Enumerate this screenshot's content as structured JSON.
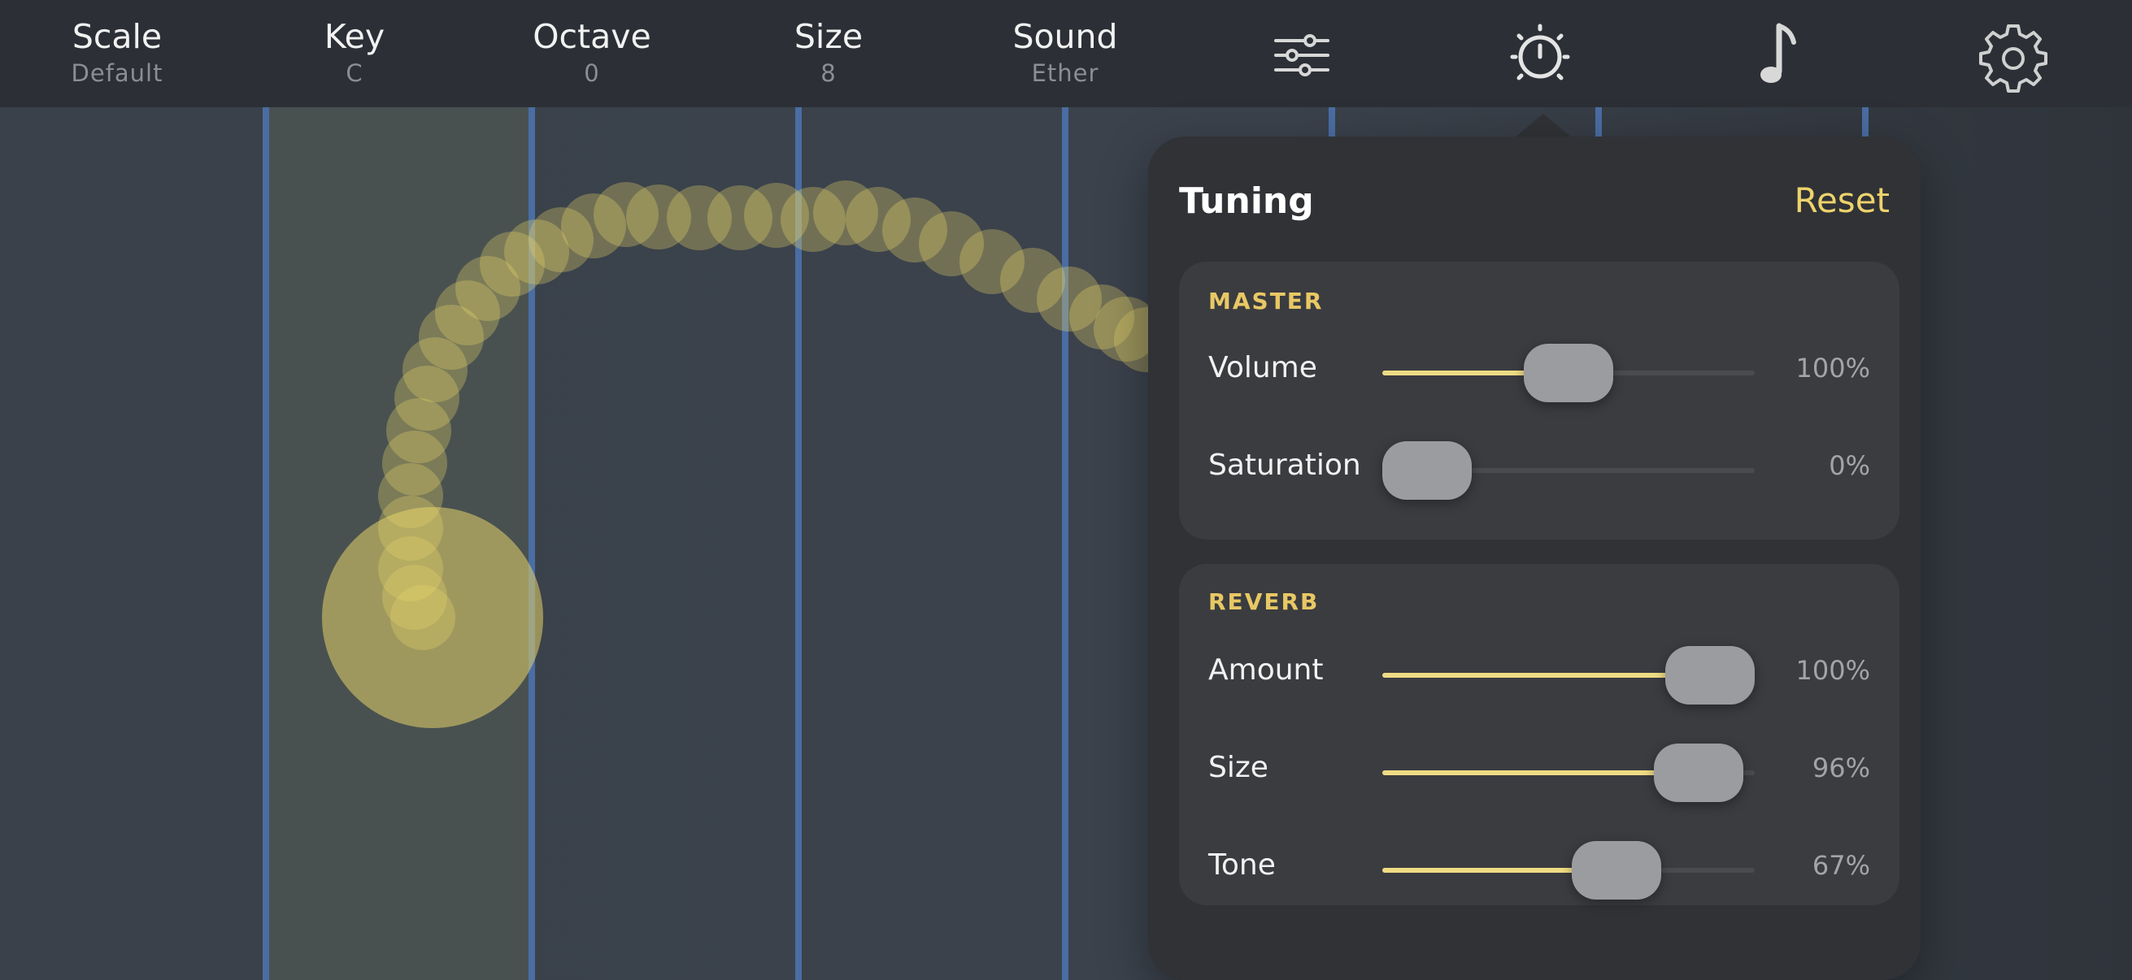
{
  "topbar": {
    "items": [
      {
        "title": "Scale",
        "value": "Default"
      },
      {
        "title": "Key",
        "value": "C"
      },
      {
        "title": "Octave",
        "value": "0"
      },
      {
        "title": "Size",
        "value": "8"
      },
      {
        "title": "Sound",
        "value": "Ether"
      }
    ],
    "icons": [
      "sliders-icon",
      "timer-icon",
      "music-note-icon",
      "gear-icon"
    ]
  },
  "stage": {
    "strings": 8,
    "highlighted_lane": 2,
    "colors": {
      "string": "#4a6da3",
      "touch": "#e6d36a",
      "highlight": "#495150"
    }
  },
  "panel": {
    "title": "Tuning",
    "reset_label": "Reset",
    "sections": [
      {
        "heading": "MASTER",
        "rows": [
          {
            "label": "Volume",
            "value_text": "100%",
            "level": 0.5
          },
          {
            "label": "Saturation",
            "value_text": "0%",
            "level": 0.0
          }
        ]
      },
      {
        "heading": "REVERB",
        "rows": [
          {
            "label": "Amount",
            "value_text": "100%",
            "level": 1.0
          },
          {
            "label": "Size",
            "value_text": "96%",
            "level": 0.96
          },
          {
            "label": "Tone",
            "value_text": "67%",
            "level": 0.67
          }
        ]
      }
    ]
  },
  "accent_color": "#eed36c"
}
